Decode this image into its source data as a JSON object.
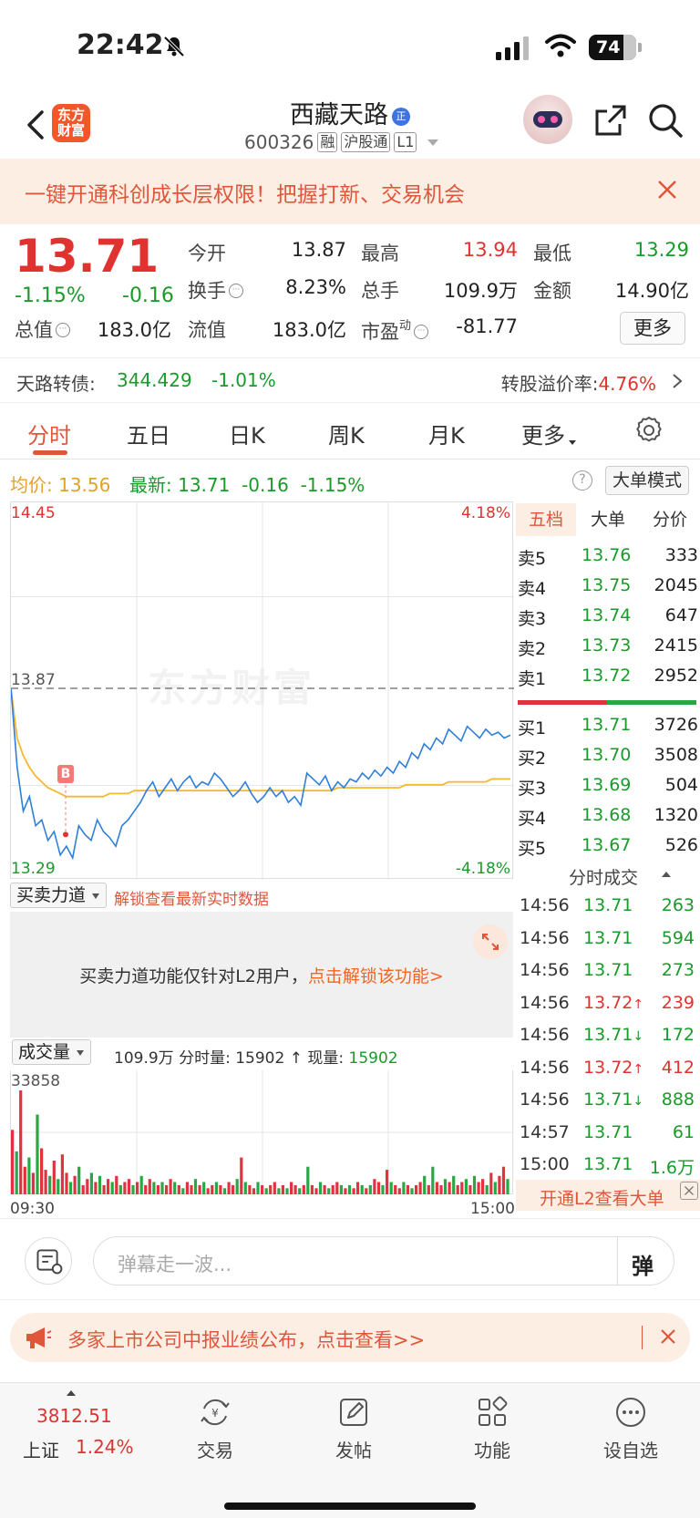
{
  "status_bar": {
    "time": "22:42",
    "battery": "74"
  },
  "header": {
    "stock_name": "西藏天路",
    "badge": "正",
    "code": "600326",
    "tags": [
      "融",
      "沪股通",
      "L1"
    ],
    "logo_line1": "东方",
    "logo_line2": "财富"
  },
  "promo": {
    "text": "一键开通科创成长层权限！把握打新、交易机会"
  },
  "quote": {
    "price": "13.71",
    "change_pct": "-1.15%",
    "change_amt": "-0.16",
    "fields": [
      {
        "label": "今开",
        "value": "13.87",
        "color": "#222"
      },
      {
        "label": "最高",
        "value": "13.94",
        "color": "#e0332f"
      },
      {
        "label": "最低",
        "value": "13.29",
        "color": "#1a9a2a"
      },
      {
        "label": "换手",
        "value": "8.23%",
        "color": "#222"
      },
      {
        "label": "总手",
        "value": "109.9万",
        "color": "#222"
      },
      {
        "label": "金额",
        "value": "14.90亿",
        "color": "#222"
      },
      {
        "label": "总值",
        "value": "183.0亿",
        "color": "#222"
      },
      {
        "label": "流值",
        "value": "183.0亿",
        "color": "#222"
      },
      {
        "label": "市盈",
        "value": "-81.77",
        "color": "#222"
      }
    ],
    "pe_sup": "动",
    "more": "更多"
  },
  "cb": {
    "label": "天路转债:",
    "price": "344.429",
    "pct": "-1.01%",
    "premium_label": "转股溢价率:",
    "premium": "4.76%"
  },
  "tabs": [
    "分时",
    "五日",
    "日K",
    "周K",
    "月K",
    "更多"
  ],
  "avg": {
    "avg_label": "均价:",
    "avg_value": "13.56",
    "latest_label": "最新:",
    "latest_value": "13.71",
    "chg": "-0.16",
    "pct": "-1.15%",
    "big_mode": "大单模式"
  },
  "chart_data": {
    "type": "line",
    "title": "",
    "y_max_label": "14.45",
    "y_min_label": "13.29",
    "pct_max_label": "4.18%",
    "pct_min_label": "-4.18%",
    "prev_close_label": "13.87",
    "watermark": "东方财富",
    "ylim": [
      13.29,
      14.45
    ],
    "prev_close": 13.87,
    "marker": "B",
    "price_series": [
      13.87,
      13.6,
      13.45,
      13.5,
      13.4,
      13.42,
      13.35,
      13.38,
      13.3,
      13.33,
      13.29,
      13.4,
      13.37,
      13.35,
      13.42,
      13.38,
      13.36,
      13.33,
      13.4,
      13.42,
      13.45,
      13.48,
      13.52,
      13.55,
      13.5,
      13.53,
      13.56,
      13.52,
      13.55,
      13.57,
      13.53,
      13.55,
      13.54,
      13.58,
      13.56,
      13.53,
      13.5,
      13.52,
      13.55,
      13.51,
      13.48,
      13.5,
      13.53,
      13.5,
      13.52,
      13.48,
      13.5,
      13.47,
      13.58,
      13.56,
      13.54,
      13.57,
      13.52,
      13.55,
      13.53,
      13.56,
      13.55,
      13.58,
      13.56,
      13.59,
      13.57,
      13.6,
      13.58,
      13.62,
      13.6,
      13.65,
      13.63,
      13.68,
      13.66,
      13.7,
      13.68,
      13.73,
      13.71,
      13.69,
      13.74,
      13.72,
      13.7,
      13.73,
      13.71,
      13.72,
      13.7,
      13.71
    ],
    "avg_series": [
      13.87,
      13.7,
      13.64,
      13.6,
      13.57,
      13.55,
      13.53,
      13.52,
      13.51,
      13.5,
      13.5,
      13.5,
      13.5,
      13.5,
      13.5,
      13.5,
      13.51,
      13.51,
      13.51,
      13.51,
      13.52,
      13.52,
      13.52,
      13.52,
      13.52,
      13.52,
      13.52,
      13.52,
      13.52,
      13.52,
      13.52,
      13.52,
      13.52,
      13.52,
      13.52,
      13.52,
      13.52,
      13.52,
      13.52,
      13.52,
      13.52,
      13.52,
      13.52,
      13.52,
      13.52,
      13.52,
      13.52,
      13.52,
      13.52,
      13.52,
      13.52,
      13.52,
      13.52,
      13.53,
      13.53,
      13.53,
      13.53,
      13.53,
      13.53,
      13.53,
      13.53,
      13.53,
      13.53,
      13.53,
      13.54,
      13.54,
      13.54,
      13.54,
      13.54,
      13.54,
      13.54,
      13.55,
      13.55,
      13.55,
      13.55,
      13.55,
      13.55,
      13.55,
      13.56,
      13.56,
      13.56,
      13.56
    ]
  },
  "power": {
    "dropdown": "买卖力道",
    "unlock": "解锁查看最新实时数据",
    "msg_prefix": "买卖力道功能仅针对L2用户，",
    "msg_link": "点击解锁该功能>"
  },
  "volume": {
    "dropdown": "成交量",
    "total": "109.9万",
    "stats_mid": "分时量: 15902",
    "arrow": "↑",
    "now_label": "现量:",
    "now_value": "15902",
    "max_label": "33858",
    "start_time": "09:30",
    "end_time": "15:00",
    "max_value": 33858,
    "bars": [
      21000,
      14000,
      33858,
      9000,
      12000,
      7000,
      26000,
      15000,
      8000,
      6000,
      11000,
      5000,
      13000,
      7000,
      4000,
      6000,
      9000,
      3000,
      5000,
      7000,
      4000,
      6000,
      3000,
      5000,
      4000,
      6000,
      3000,
      4000,
      5000,
      3000,
      4000,
      6000,
      3000,
      5000,
      4000,
      3000,
      4000,
      3000,
      5000,
      4000,
      3000,
      2000,
      4000,
      3000,
      5000,
      3000,
      4000,
      2000,
      3000,
      4000,
      3000,
      2000,
      4000,
      3000,
      5000,
      12000,
      4000,
      3000,
      2000,
      4000,
      3000,
      2000,
      3000,
      4000,
      2000,
      3000,
      2000,
      4000,
      3000,
      2000,
      3000,
      9000,
      3000,
      2000,
      4000,
      3000,
      2000,
      3000,
      4000,
      3000,
      2000,
      3000,
      2000,
      4000,
      3000,
      2000,
      3000,
      5000,
      4000,
      3000,
      8000,
      4000,
      3000,
      2000,
      4000,
      3000,
      2000,
      3000,
      4000,
      6000,
      3000,
      9000,
      4000,
      3000,
      5000,
      4000,
      6000,
      3000,
      4000,
      5000,
      3000,
      6000,
      4000,
      5000,
      3000,
      7000,
      4000,
      6000,
      9000,
      5000
    ]
  },
  "orderbook": {
    "tabs": [
      "五档",
      "大单",
      "分价"
    ],
    "asks": [
      {
        "k": "卖5",
        "p": "13.76",
        "v": "333"
      },
      {
        "k": "卖4",
        "p": "13.75",
        "v": "2045"
      },
      {
        "k": "卖3",
        "p": "13.74",
        "v": "647"
      },
      {
        "k": "卖2",
        "p": "13.73",
        "v": "2415"
      },
      {
        "k": "卖1",
        "p": "13.72",
        "v": "2952"
      }
    ],
    "bids": [
      {
        "k": "买1",
        "p": "13.71",
        "v": "3726"
      },
      {
        "k": "买2",
        "p": "13.70",
        "v": "3508"
      },
      {
        "k": "买3",
        "p": "13.69",
        "v": "504"
      },
      {
        "k": "买4",
        "p": "13.68",
        "v": "1320"
      },
      {
        "k": "买5",
        "p": "13.67",
        "v": "526"
      }
    ]
  },
  "ticks": {
    "title": "分时成交",
    "rows": [
      {
        "t": "14:56",
        "p": "13.71",
        "arrow": "",
        "v": "263",
        "c": "#1a9a2a"
      },
      {
        "t": "14:56",
        "p": "13.71",
        "arrow": "",
        "v": "594",
        "c": "#1a9a2a"
      },
      {
        "t": "14:56",
        "p": "13.71",
        "arrow": "",
        "v": "273",
        "c": "#1a9a2a"
      },
      {
        "t": "14:56",
        "p": "13.72",
        "arrow": "↑",
        "v": "239",
        "c": "#e0332f"
      },
      {
        "t": "14:56",
        "p": "13.71",
        "arrow": "↓",
        "v": "172",
        "c": "#1a9a2a"
      },
      {
        "t": "14:56",
        "p": "13.72",
        "arrow": "↑",
        "v": "412",
        "c": "#e0332f"
      },
      {
        "t": "14:56",
        "p": "13.71",
        "arrow": "↓",
        "v": "888",
        "c": "#1a9a2a"
      },
      {
        "t": "14:57",
        "p": "13.71",
        "arrow": "",
        "v": "61",
        "c": "#1a9a2a"
      },
      {
        "t": "15:00",
        "p": "13.71",
        "arrow": "",
        "v": "1.6万",
        "c": "#1a9a2a"
      }
    ],
    "l2": "开通L2查看大单"
  },
  "comment": {
    "placeholder": "弹幕走一波...",
    "send": "弹"
  },
  "announce": {
    "text": "多家上市公司中报业绩公布，点击查看>>"
  },
  "bottom_nav": {
    "index_value": "3812.51",
    "index_name": "上证",
    "index_pct": "1.24%",
    "items": [
      "交易",
      "发帖",
      "功能",
      "设自选"
    ]
  }
}
